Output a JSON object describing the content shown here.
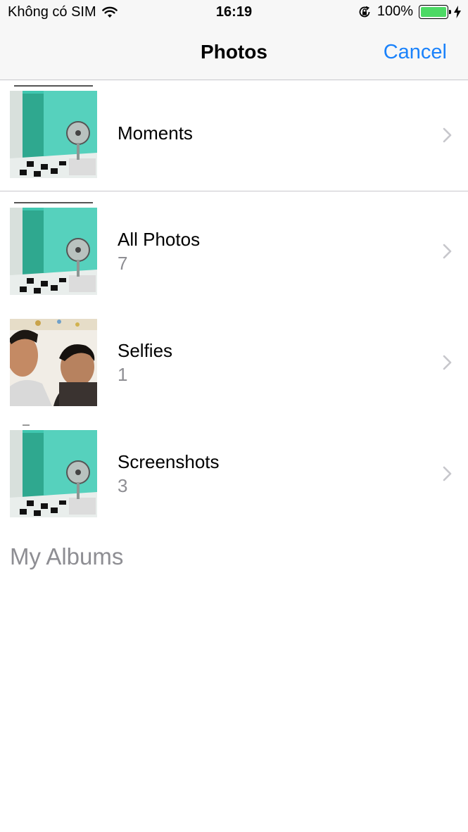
{
  "status_bar": {
    "carrier": "Không có SIM",
    "time": "16:19",
    "battery_percent": "100%",
    "battery_color": "#4cd964",
    "battery_level": 1.0,
    "icons": [
      "wifi-icon",
      "orientation-lock-icon",
      "battery-icon",
      "charging-bolt-icon"
    ]
  },
  "nav": {
    "title": "Photos",
    "cancel_label": "Cancel",
    "accent_color": "#1a82fb"
  },
  "rows": [
    {
      "title": "Moments",
      "count": "",
      "thumbnail": "room-fan-photo"
    },
    {
      "title": "All Photos",
      "count": "7",
      "thumbnail": "room-fan-photo"
    },
    {
      "title": "Selfies",
      "count": "1",
      "thumbnail": "selfie-photo"
    },
    {
      "title": "Screenshots",
      "count": "3",
      "thumbnail": "room-fan-photo"
    }
  ],
  "section": {
    "my_albums": "My Albums"
  }
}
